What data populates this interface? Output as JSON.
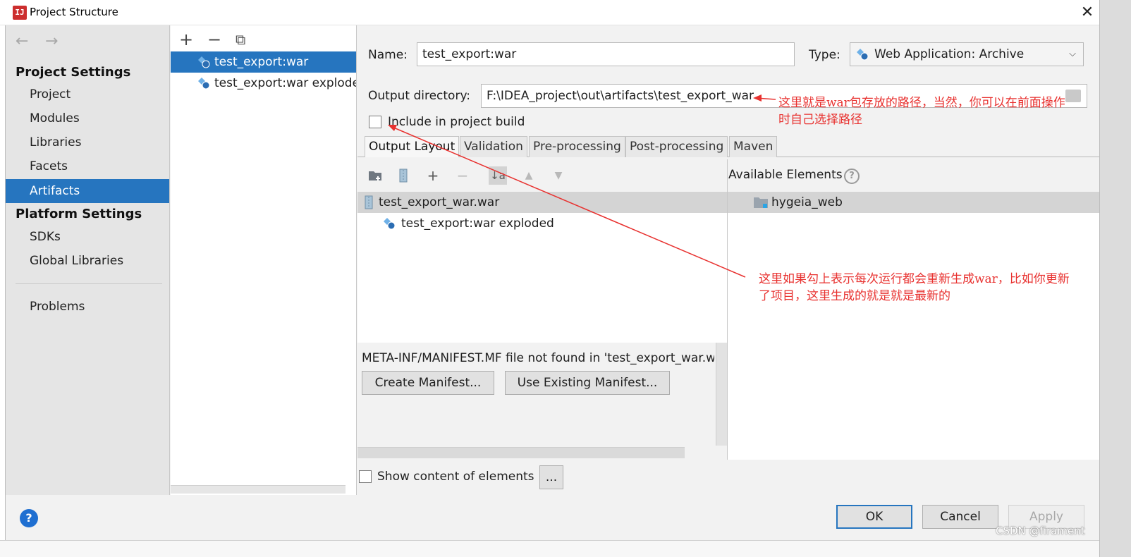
{
  "window": {
    "title": "Project Structure",
    "close_glyph": "✕"
  },
  "nav": {
    "back_glyph": "←",
    "forward_glyph": "→",
    "project_settings": "Project Settings",
    "project_items": [
      "Project",
      "Modules",
      "Libraries",
      "Facets",
      "Artifacts"
    ],
    "selected": "Artifacts",
    "platform_settings": "Platform Settings",
    "platform_items": [
      "SDKs",
      "Global Libraries"
    ],
    "problems": "Problems"
  },
  "artifacts_list": {
    "add_glyph": "+",
    "remove_glyph": "−",
    "copy_glyph": "⧉",
    "items": [
      "test_export:war",
      "test_export:war exploded"
    ]
  },
  "form": {
    "name_label": "Name:",
    "name_value": "test_export:war",
    "type_label": "Type:",
    "type_value": "Web Application: Archive",
    "output_label": "Output directory:",
    "output_value": "F:\\IDEA_project\\out\\artifacts\\test_export_war",
    "include_label": "Include in project build",
    "include_checked": false
  },
  "tabs": [
    "Output Layout",
    "Validation",
    "Pre-processing",
    "Post-processing",
    "Maven"
  ],
  "layout": {
    "toolbar": [
      "folder-add-icon",
      "archive-icon",
      "add-icon",
      "remove-icon",
      "sort-icon",
      "up-icon",
      "down-icon"
    ],
    "add_glyph": "+",
    "remove_glyph": "−",
    "sort_glyph": "↓a",
    "up_glyph": "▲",
    "down_glyph": "▼",
    "tree": [
      "test_export_war.war",
      "test_export:war exploded"
    ],
    "available_header": "Available Elements",
    "help_glyph": "?",
    "available": [
      "hygeia_web"
    ],
    "manifest_message": "META-INF/MANIFEST.MF file not found in 'test_export_war.war'",
    "create_manifest": "Create Manifest...",
    "use_existing_manifest": "Use Existing Manifest...",
    "show_content_label": "Show content of elements",
    "ellipsis_button": "..."
  },
  "footer": {
    "help_glyph": "?",
    "ok": "OK",
    "cancel": "Cancel",
    "apply": "Apply"
  },
  "annotations": {
    "top": [
      "这里就是war包存放的路径，当然，你可以在前面操作",
      "时自己选择路径"
    ],
    "bottom": [
      "这里如果勾上表示每次运行都会重新生成war，比如你更新",
      "了项目，这里生成的就是就是最新的"
    ]
  },
  "watermark": "CSDN @firament",
  "colors": {
    "selection": "#2675bf",
    "annotation": "#e8312f"
  }
}
